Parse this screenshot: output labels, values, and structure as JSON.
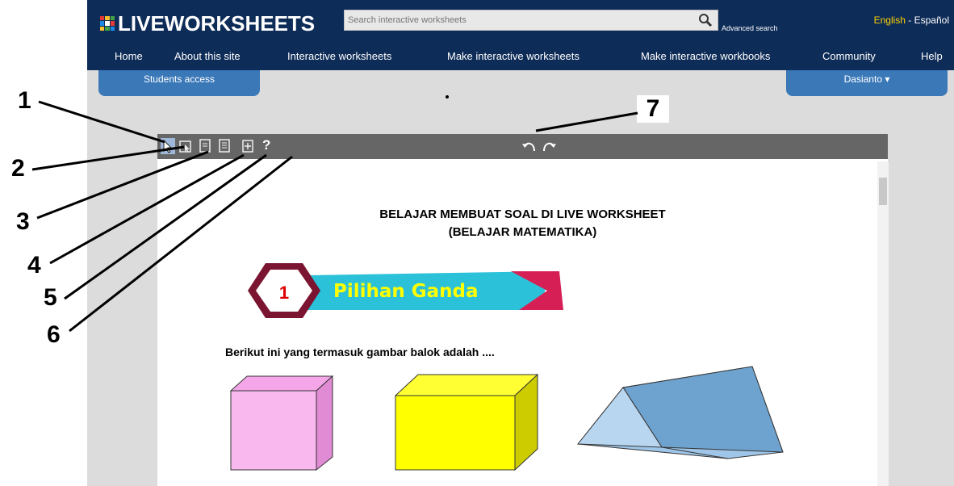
{
  "header": {
    "logo_text": "LIVEWORKSHEETS",
    "search_placeholder": "Search interactive worksheets",
    "advanced_search": "Advanced search",
    "lang_english": "English",
    "lang_sep": " - ",
    "lang_spanish": "Español"
  },
  "nav": {
    "items": [
      "Home",
      "About this site",
      "Interactive worksheets",
      "Make interactive worksheets",
      "Make interactive workbooks",
      "Community",
      "Help"
    ]
  },
  "students_access": "Students access",
  "user_menu": "Dasianto",
  "worksheet": {
    "title_line1": "BELAJAR MEMBUAT SOAL DI LIVE WORKSHEET",
    "title_line2": "(BELAJAR MATEMATIKA)",
    "banner_number": "1",
    "banner_text": "Pilihan Ganda",
    "question": "Berikut ini yang termasuk gambar balok adalah ...."
  },
  "toolbar": {
    "help_symbol": "?",
    "icons": [
      "pointer-icon",
      "select-icon",
      "draw-icon",
      "note-icon",
      "insert-icon",
      "help-icon",
      "undo-icon",
      "redo-icon"
    ]
  },
  "annotations": [
    "1",
    "2",
    "3",
    "4",
    "5",
    "6",
    "7"
  ],
  "colors": {
    "header_bg": "#0e2c58",
    "tab_blue": "#3a78b8",
    "toolbar_gray": "#666666",
    "banner_cyan": "#2bc1d8",
    "banner_maroon": "#7a1430",
    "banner_text": "#ffff00",
    "cube_pink": "#f9b8ee",
    "cube_yellow": "#ffff00",
    "prism_blue": "#7ab0d8"
  }
}
